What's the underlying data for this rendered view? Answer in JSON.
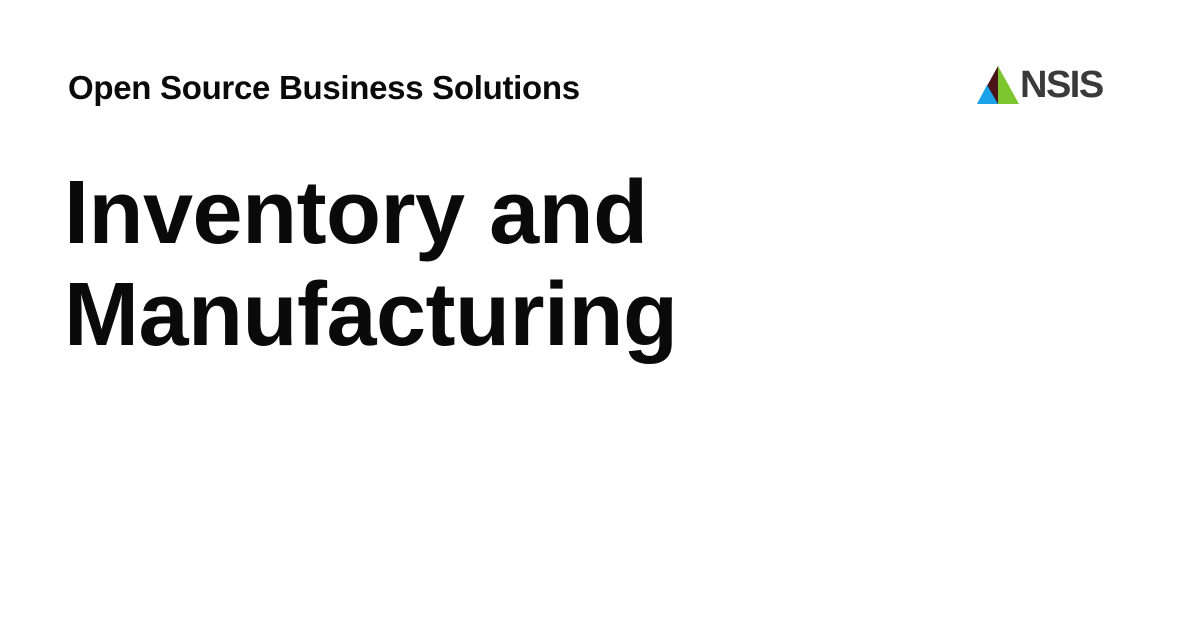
{
  "header": {
    "tagline": "Open Source Business Solutions"
  },
  "logo": {
    "text": "NSIS",
    "icon": "tricolor-triangle-logo-icon",
    "text_color": "#3a3a3a",
    "mark_colors": {
      "dark": "#4a1418",
      "green": "#7dc630",
      "blue": "#1aa3e8"
    }
  },
  "headline": {
    "line1": "Inventory and",
    "line2": "Manufacturing"
  },
  "colors": {
    "background": "#ffffff",
    "text": "#0a0a0a"
  }
}
